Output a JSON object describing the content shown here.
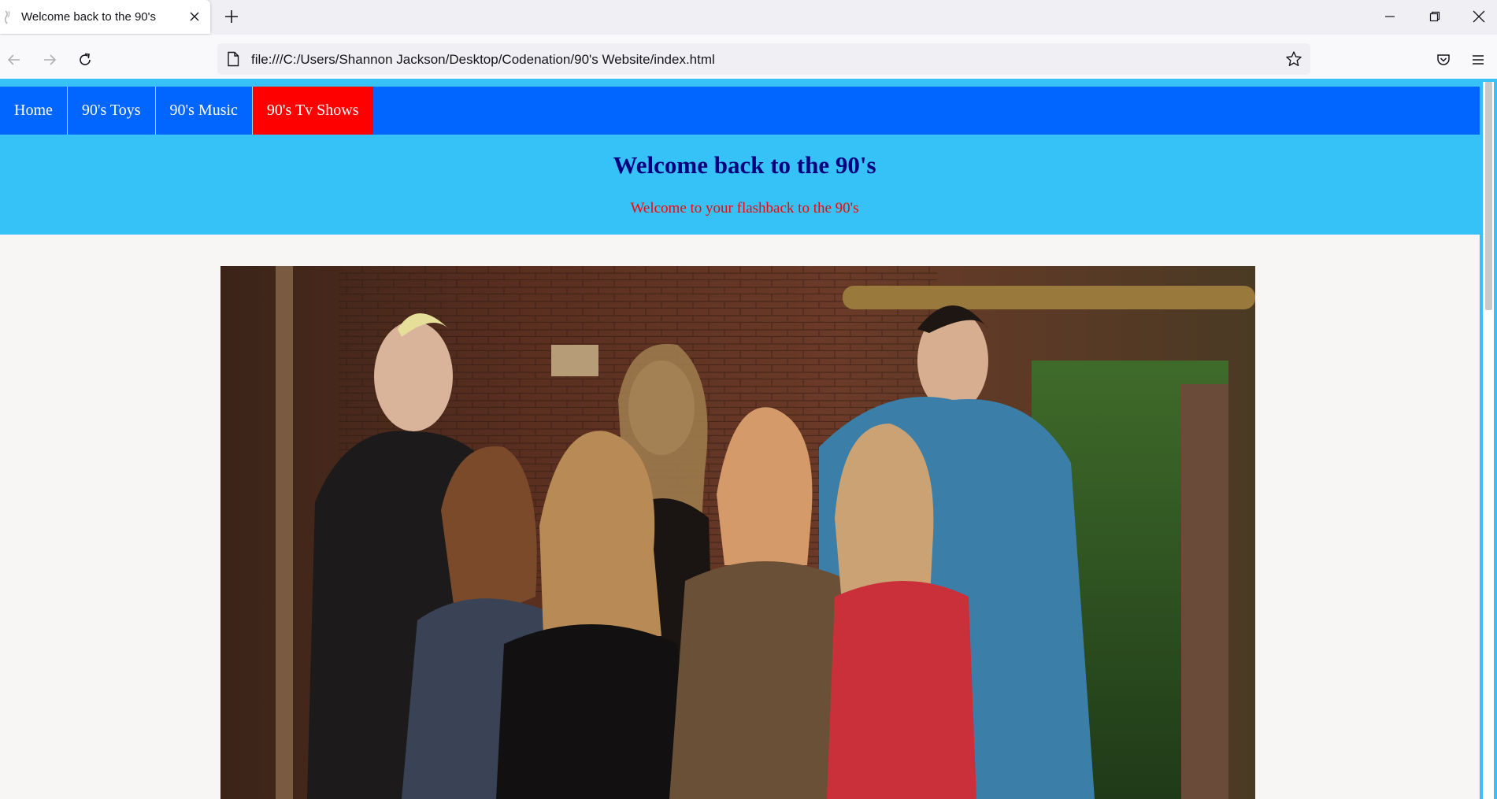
{
  "browser": {
    "tab_title": "Welcome back to the 90's",
    "url": "file:///C:/Users/Shannon Jackson/Desktop/Codenation/90's Website/index.html",
    "icons": [
      "page-icon",
      "close-icon",
      "plus-icon",
      "minimize-icon",
      "restore-icon",
      "window-close-icon",
      "back-arrow-icon",
      "forward-arrow-icon",
      "reload-icon",
      "bookmark-star-icon",
      "pocket-icon",
      "hamburger-menu-icon"
    ]
  },
  "page": {
    "menu": [
      {
        "label": "Home"
      },
      {
        "label": "90's Toys"
      },
      {
        "label": "90's Music"
      },
      {
        "label": "90's Tv Shows",
        "active": true
      }
    ],
    "heading": "Welcome back to the 90's",
    "subheading": "Welcome to your flashback to the 90's",
    "colors": {
      "header_bg": "#36c2f6",
      "menu_bg": "#0066ff",
      "active_menu_bg": "#ff0000",
      "heading": "#00007d",
      "subheading": "#ff0000"
    }
  }
}
